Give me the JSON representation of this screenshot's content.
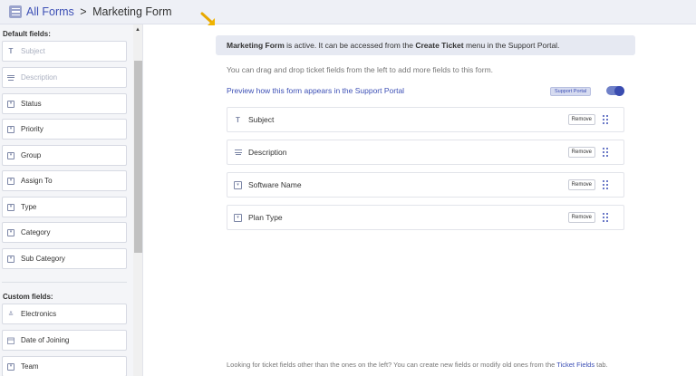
{
  "header": {
    "menu_icon": "hamburger-icon",
    "breadcrumb_link": "All Forms",
    "separator": ">",
    "current": "Marketing Form"
  },
  "sidebar": {
    "default_title": "Default fields:",
    "default_fields": [
      {
        "label": "Subject",
        "icon": "text-icon",
        "muted": true
      },
      {
        "label": "Description",
        "icon": "paragraph-icon",
        "muted": true
      },
      {
        "label": "Status",
        "icon": "dropdown-icon"
      },
      {
        "label": "Priority",
        "icon": "dropdown-icon"
      },
      {
        "label": "Group",
        "icon": "dropdown-icon"
      },
      {
        "label": "Assign To",
        "icon": "dropdown-icon"
      },
      {
        "label": "Type",
        "icon": "dropdown-icon"
      },
      {
        "label": "Category",
        "icon": "dropdown-icon"
      },
      {
        "label": "Sub Category",
        "icon": "dropdown-icon"
      }
    ],
    "custom_title": "Custom fields:",
    "custom_fields": [
      {
        "label": "Electronics",
        "icon": "multi-select-icon"
      },
      {
        "label": "Date of Joining",
        "icon": "calendar-icon"
      },
      {
        "label": "Team",
        "icon": "dropdown-icon"
      }
    ]
  },
  "main": {
    "banner": {
      "form_name": "Marketing Form",
      "text_a": " is active. It can be accessed from the ",
      "menu_name": "Create Ticket",
      "text_b": " menu in the Support Portal."
    },
    "hint": "You can drag and drop ticket fields from the left to add more fields to this form.",
    "preview_link": "Preview how this form appears in the Support Portal",
    "portal_tag": "Support Portal",
    "toggle_on": true,
    "form_fields": [
      {
        "label": "Subject",
        "icon": "text-icon",
        "remove_label": "Remove"
      },
      {
        "label": "Description",
        "icon": "paragraph-icon",
        "remove_label": "Remove"
      },
      {
        "label": "Software Name",
        "icon": "dropdown-icon",
        "remove_label": "Remove"
      },
      {
        "label": "Plan Type",
        "icon": "dropdown-icon",
        "remove_label": "Remove"
      }
    ],
    "footer_text": "Looking for ticket fields other than the ones on the left? You can create new fields or modify old ones from the ",
    "footer_link": "Ticket Fields",
    "footer_end": " tab."
  },
  "colors": {
    "accent": "#3c4fb5",
    "arrow": "#f0b400"
  }
}
